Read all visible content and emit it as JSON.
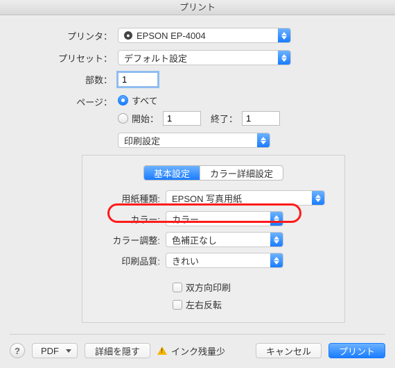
{
  "window": {
    "title": "プリント"
  },
  "printer": {
    "label": "プリンタ：",
    "value": "EPSON EP-4004"
  },
  "preset": {
    "label": "プリセット：",
    "value": "デフォルト設定"
  },
  "copies": {
    "label": "部数：",
    "value": "1"
  },
  "pages": {
    "label": "ページ：",
    "all_label": "すべて",
    "range_from_label": "開始：",
    "range_to_label": "終了：",
    "from_value": "1",
    "to_value": "1",
    "selected": "all"
  },
  "dropdown": {
    "value": "印刷設定"
  },
  "tabs": {
    "basic": "基本設定",
    "advanced": "カラー詳細設定",
    "active": "basic"
  },
  "settings": {
    "paper_type": {
      "label": "用紙種類:",
      "value": "EPSON 写真用紙"
    },
    "color": {
      "label": "カラー:",
      "value": "カラー"
    },
    "color_adjust": {
      "label": "カラー調整:",
      "value": "色補正なし"
    },
    "quality": {
      "label": "印刷品質:",
      "value": "きれい"
    },
    "bidirectional": {
      "label": "双方向印刷",
      "checked": false
    },
    "mirror": {
      "label": "左右反転",
      "checked": false
    }
  },
  "footer": {
    "pdf": "PDF",
    "details_hide": "詳細を隠す",
    "ink": "インク残量少",
    "cancel": "キャンセル",
    "print": "プリント"
  }
}
